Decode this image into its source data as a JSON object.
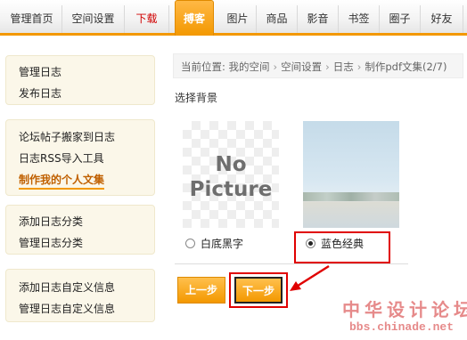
{
  "nav": {
    "tabs": [
      {
        "label": "管理首页"
      },
      {
        "label": "空间设置"
      },
      {
        "label": "下载"
      },
      {
        "label": "搏客"
      },
      {
        "label": "图片"
      },
      {
        "label": "商品"
      },
      {
        "label": "影音"
      },
      {
        "label": "书签"
      },
      {
        "label": "圈子"
      },
      {
        "label": "好友"
      }
    ],
    "active_tab": "搏客",
    "highlight_tab": "下载"
  },
  "sidebar": {
    "groups": [
      {
        "items": [
          {
            "label": "管理日志"
          },
          {
            "label": "发布日志"
          }
        ]
      },
      {
        "items": [
          {
            "label": "论坛帖子搬家到日志"
          },
          {
            "label": "日志RSS导入工具"
          },
          {
            "label": "制作我的个人文集"
          }
        ]
      },
      {
        "items": [
          {
            "label": "添加日志分类"
          },
          {
            "label": "管理日志分类"
          }
        ]
      },
      {
        "items": [
          {
            "label": "添加日志自定义信息"
          },
          {
            "label": "管理日志自定义信息"
          }
        ]
      }
    ],
    "current_item": "制作我的个人文集"
  },
  "breadcrumb": {
    "prefix": "当前位置: 我的空间",
    "parts": [
      "空间设置",
      "日志",
      "制作pdf文集(2/7)"
    ]
  },
  "main": {
    "section_title": "选择背景",
    "nopicture_text": [
      "No",
      "Picture"
    ],
    "options": [
      {
        "label": "白底黑字",
        "selected": false
      },
      {
        "label": "蓝色经典",
        "selected": true
      }
    ],
    "prev_button": "上一步",
    "next_button": "下一步"
  },
  "watermark": {
    "title": "中华设计论坛",
    "url": "bbs.chinade.net"
  },
  "colors": {
    "accent": "#f39800",
    "annotation": "#e00000",
    "sidebar_bg": "#fbf7e9"
  }
}
